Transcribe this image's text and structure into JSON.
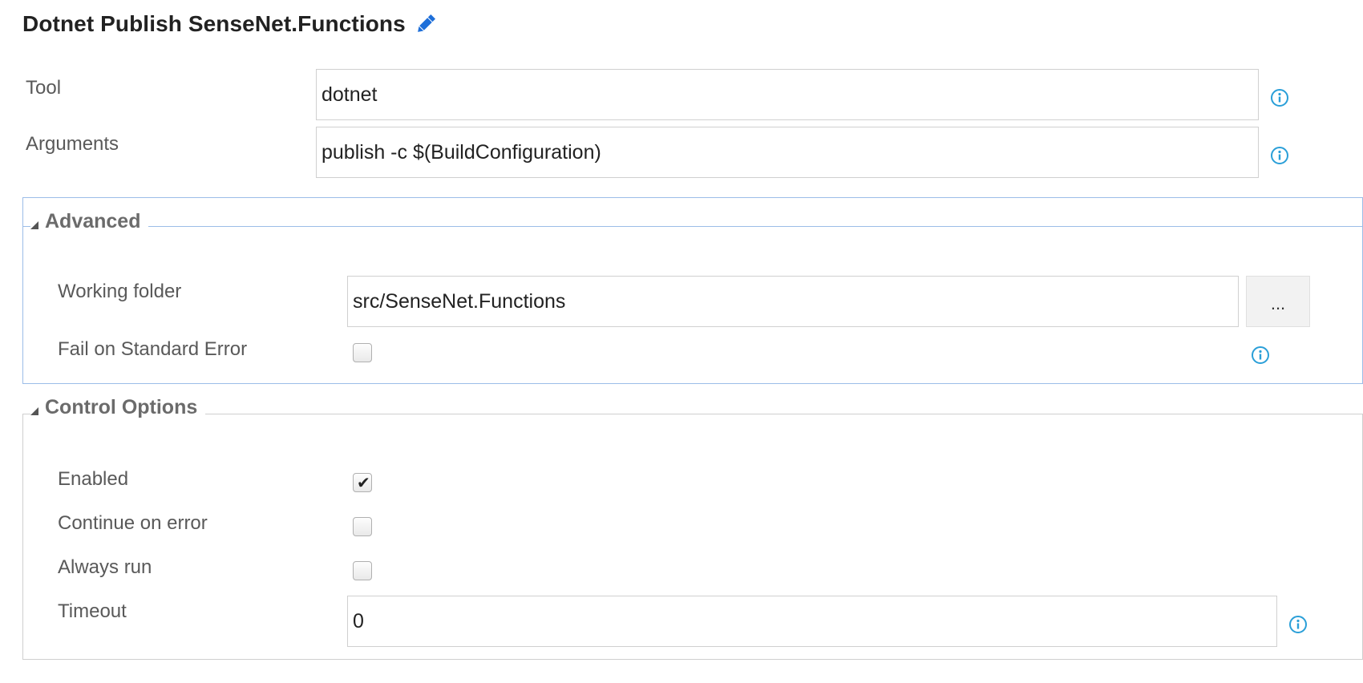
{
  "task": {
    "title": "Dotnet Publish SenseNet.Functions",
    "edit_icon": "pencil-icon"
  },
  "fields": {
    "tool": {
      "label": "Tool",
      "value": "dotnet"
    },
    "arguments": {
      "label": "Arguments",
      "value": "publish -c $(BuildConfiguration)"
    }
  },
  "advanced": {
    "title": "Advanced",
    "working_folder": {
      "label": "Working folder",
      "value": "src/SenseNet.Functions",
      "browse_label": "..."
    },
    "fail_on_stderr": {
      "label": "Fail on Standard Error",
      "checked": false
    }
  },
  "control_options": {
    "title": "Control Options",
    "enabled": {
      "label": "Enabled",
      "checked": true,
      "checkmark": "✔"
    },
    "continue_on_error": {
      "label": "Continue on error",
      "checked": false
    },
    "always_run": {
      "label": "Always run",
      "checked": false
    },
    "timeout": {
      "label": "Timeout",
      "value": "0"
    }
  },
  "colors": {
    "info_icon": "#2a9fd8",
    "pencil": "#1e6fd9",
    "advanced_border": "#9cbde8",
    "section_border": "#cfcfcf"
  }
}
